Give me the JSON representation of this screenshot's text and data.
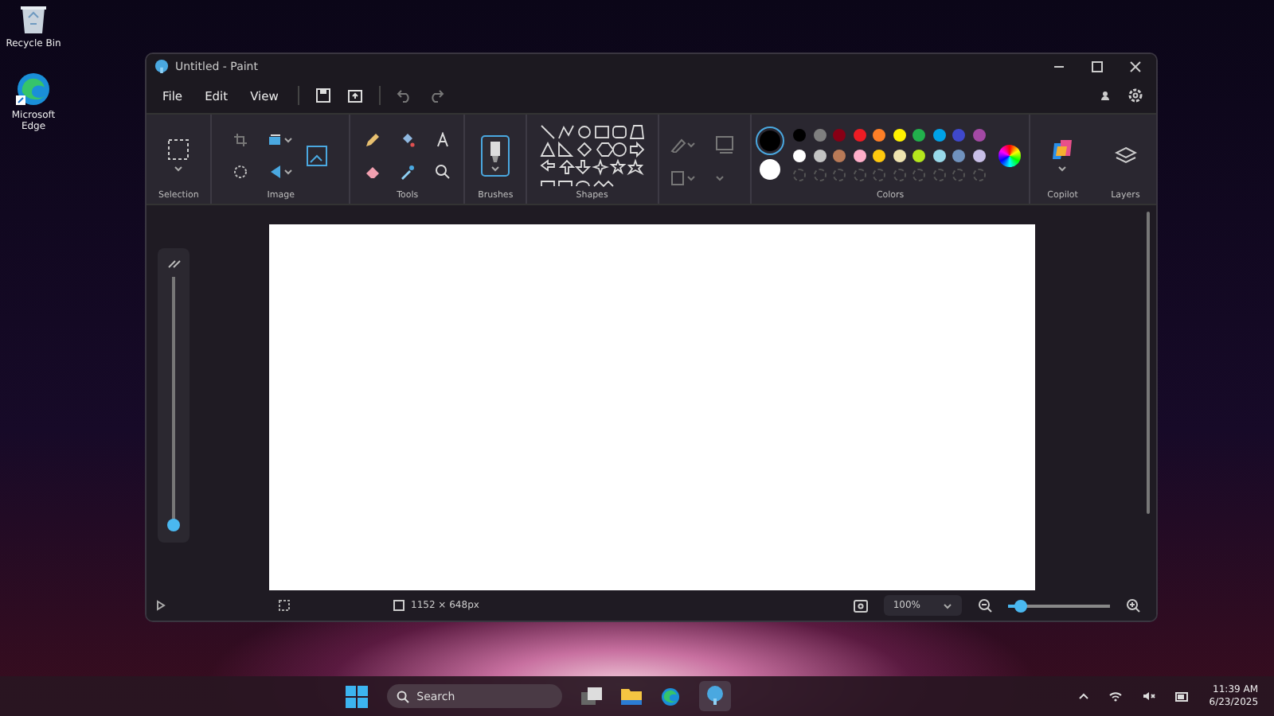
{
  "desktop_icons": [
    {
      "label": "Recycle Bin",
      "kind": "bin"
    },
    {
      "label": "Microsoft Edge",
      "kind": "edge"
    }
  ],
  "window": {
    "title": "Untitled - Paint"
  },
  "menu": [
    "File",
    "Edit",
    "View"
  ],
  "ribbon": {
    "groups": [
      {
        "label": "Selection",
        "kind": "selection"
      },
      {
        "label": "Image",
        "kind": "image"
      },
      {
        "label": "Tools",
        "kind": "tools"
      },
      {
        "label": "Brushes",
        "kind": "brushes"
      },
      {
        "label": "Shapes",
        "kind": "shapes"
      },
      {
        "kind": "shape_style"
      },
      {
        "label": "Colors",
        "kind": "colors"
      },
      {
        "label": "Copilot",
        "kind": "copilot"
      },
      {
        "label": "Layers",
        "kind": "layers"
      }
    ]
  },
  "current_colors": [
    {
      "color": "#000000",
      "selected": true
    },
    {
      "color": "#ffffff",
      "selected": false
    }
  ],
  "swatches": [
    {
      "color": "#000000"
    },
    {
      "color": "#7f7f7f"
    },
    {
      "color": "#880015"
    },
    {
      "color": "#ed1c24"
    },
    {
      "color": "#ff7f27"
    },
    {
      "color": "#fff200"
    },
    {
      "color": "#22b14c"
    },
    {
      "color": "#00a2e8"
    },
    {
      "color": "#3f48cc"
    },
    {
      "color": "#a349a4"
    },
    {
      "color": "#ffffff"
    },
    {
      "color": "#c3c3c3"
    },
    {
      "color": "#b97a57"
    },
    {
      "color": "#ffaec9"
    },
    {
      "color": "#ffc90e"
    },
    {
      "color": "#efe4b0"
    },
    {
      "color": "#b5e61d"
    },
    {
      "color": "#99d9ea"
    },
    {
      "color": "#7092be"
    },
    {
      "color": "#c8bfe7"
    }
  ],
  "brush_size": {
    "level": 0.02
  },
  "status_bar": {
    "canvas_size": "1152 × 648px",
    "zoom": "100%",
    "zoom_slider": {
      "level": 0.12
    }
  },
  "taskbar": {
    "search_placeholder": "Search",
    "time": "11:39 AM",
    "date": "6/23/2025"
  }
}
